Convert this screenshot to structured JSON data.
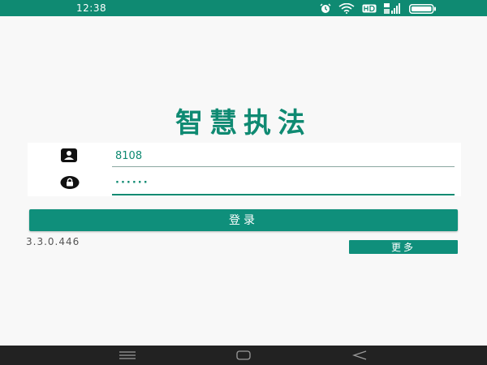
{
  "status_bar": {
    "time": "12:38",
    "background": "#0f8a72",
    "icons": [
      "alarm-icon",
      "wifi-icon",
      "hd-icon",
      "signal-icon",
      "battery-icon"
    ]
  },
  "app": {
    "title": "智慧执法",
    "brand_color": "#0f8a72"
  },
  "login_form": {
    "username": {
      "icon": "user-badge-icon",
      "value": "8108"
    },
    "password": {
      "icon": "lock-icon",
      "value": "······"
    },
    "login_label": "登录"
  },
  "footer": {
    "version": "3.3.0.446",
    "more_label": "更多"
  },
  "nav_bar": {
    "buttons": [
      "menu-icon",
      "home-icon",
      "back-icon"
    ]
  }
}
